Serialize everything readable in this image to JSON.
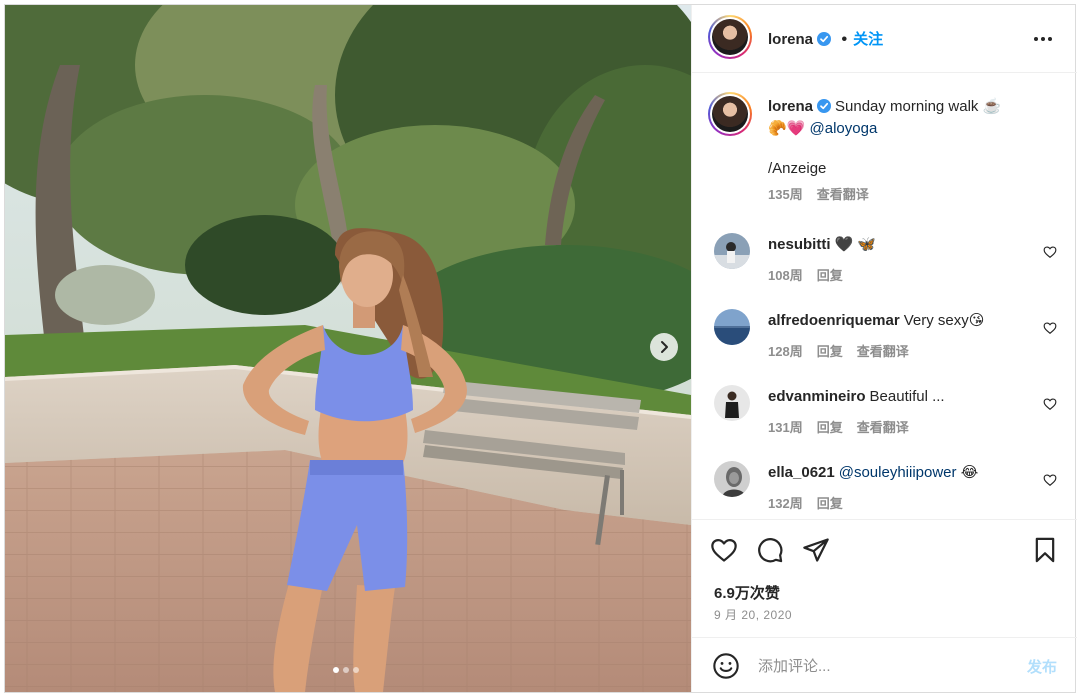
{
  "post": {
    "author": "lorena",
    "verified": true,
    "follow_label": "关注",
    "caption": {
      "username": "lorena",
      "text": "Sunday morning walk ☕️",
      "emoji_line": "🥐💗",
      "mention": "@aloyoga",
      "ad_label": "/Anzeige",
      "age": "135周",
      "translate_label": "查看翻译"
    },
    "comments": [
      {
        "username": "nesubitti",
        "text": "🖤 🦋",
        "mention": "",
        "age": "108周",
        "reply_label": "回复",
        "translate_label": ""
      },
      {
        "username": "alfredoenriquemar",
        "text": "Very sexy😘",
        "mention": "",
        "age": "128周",
        "reply_label": "回复",
        "translate_label": "查看翻译"
      },
      {
        "username": "edvanmineiro",
        "text": "Beautiful ...",
        "mention": "",
        "age": "131周",
        "reply_label": "回复",
        "translate_label": "查看翻译"
      },
      {
        "username": "ella_0621",
        "text": "😂",
        "mention": "@souleyhiiipower",
        "age": "132周",
        "reply_label": "回复",
        "translate_label": ""
      }
    ],
    "likes": "6.9万次赞",
    "date": "9 月 20, 2020",
    "comment_placeholder": "添加评论...",
    "post_label": "发布",
    "carousel": {
      "slides": 3,
      "active": 1
    }
  },
  "icons": {
    "verified": "verified-badge-icon",
    "more": "more-options-icon",
    "next": "chevron-right-icon",
    "like": "heart-icon",
    "comment": "comment-bubble-icon",
    "share": "paper-plane-icon",
    "save": "bookmark-icon",
    "emoji": "smiley-icon"
  },
  "colors": {
    "accent": "#0095f6",
    "post_disabled": "#b2dffc",
    "muted": "#8e8e8e",
    "text": "#262626",
    "mention": "#00376b",
    "outfit": "#7b8fe8"
  }
}
